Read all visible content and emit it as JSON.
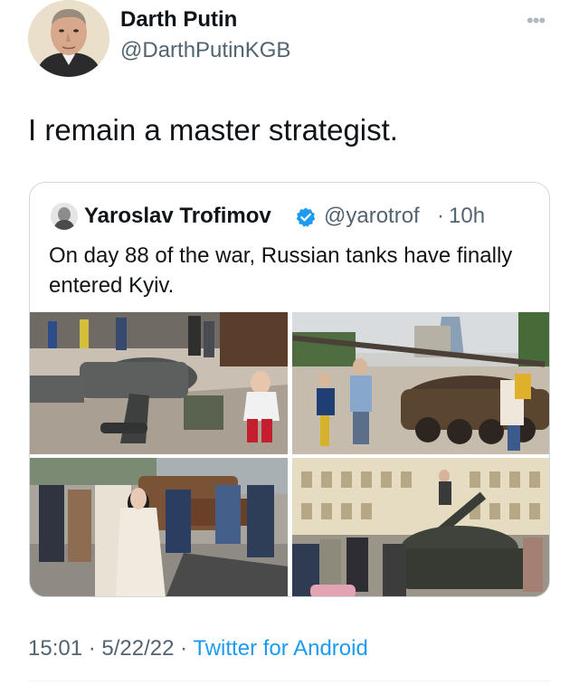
{
  "author": {
    "display_name": "Darth Putin",
    "handle": "@DarthPutinKGB"
  },
  "tweet": {
    "text": "I remain a master strategist.",
    "time": "15:01",
    "separator": "·",
    "date": "5/22/22",
    "source": "Twitter for Android"
  },
  "quoted_tweet": {
    "display_name": "Yaroslav Trofimov",
    "handle": "@yarotrof",
    "separator": "·",
    "age": "10h",
    "text": "On day 88 of the war, Russian tanks have finally entered Kyiv.",
    "verified_color": "#1d9bf0"
  },
  "icons": {
    "more": "more-options-icon",
    "verified": "verified-badge-icon"
  },
  "colors": {
    "accent": "#1d9bf0",
    "secondary_text": "#536471",
    "border": "#cfd9de"
  }
}
